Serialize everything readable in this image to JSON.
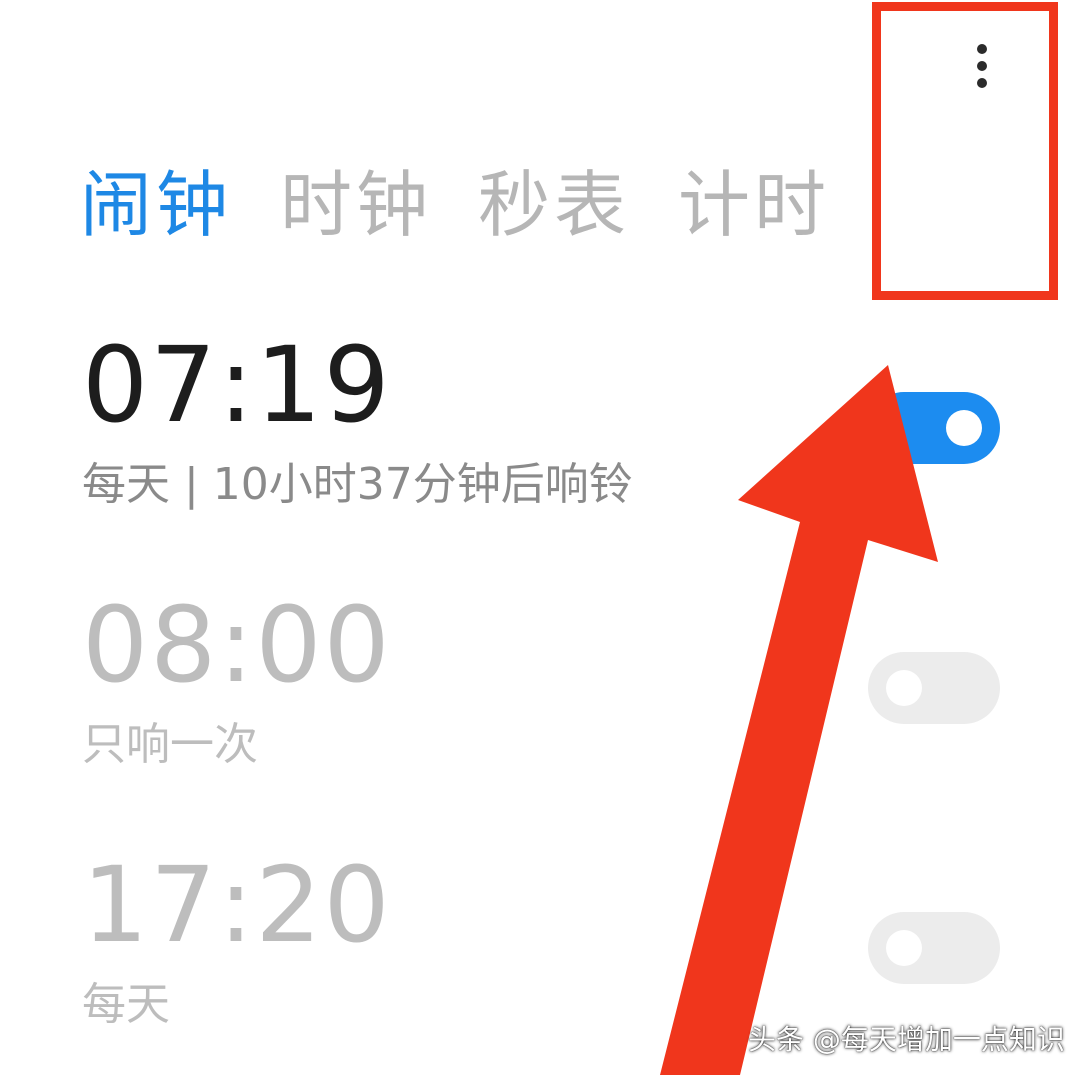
{
  "menu": {
    "icon": "more-vertical-icon"
  },
  "tabs": [
    {
      "label": "闹钟",
      "active": true
    },
    {
      "label": "时钟",
      "active": false
    },
    {
      "label": "秒表",
      "active": false
    },
    {
      "label": "计时",
      "active": false
    }
  ],
  "alarms": [
    {
      "time": "07:19",
      "subtitle": "每天 | 10小时37分钟后响铃",
      "enabled": true
    },
    {
      "time": "08:00",
      "subtitle": "只响一次",
      "enabled": false
    },
    {
      "time": "17:20",
      "subtitle": "每天",
      "enabled": false
    }
  ],
  "annotation": {
    "color": "#f0361c"
  },
  "colors": {
    "accent": "#1e88e5",
    "toggle_on": "#1c8cf0",
    "toggle_off": "#ececec"
  },
  "watermark": "头条 @每天增加一点知识"
}
